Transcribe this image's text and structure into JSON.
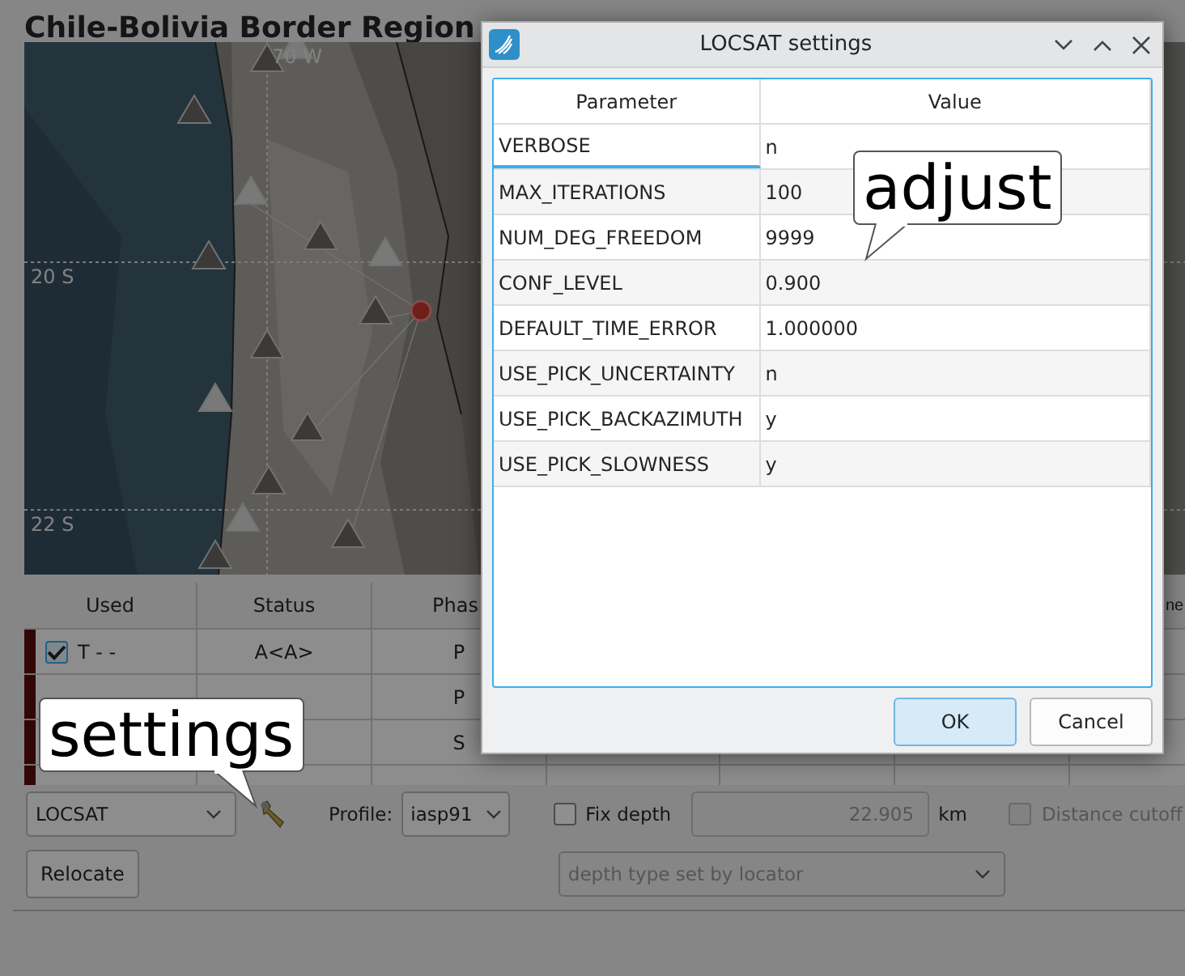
{
  "app": {
    "title": "Chile-Bolivia Border Region",
    "map": {
      "kind": "picture",
      "grid_labels": [
        "70 W",
        "20 S",
        "22 S"
      ]
    },
    "arrivals": {
      "columns": [
        {
          "label": "Used"
        },
        {
          "label": "Status"
        },
        {
          "label": "Phas"
        },
        {},
        {},
        {},
        {
          "label": "ne"
        }
      ],
      "rows": [
        {
          "used": {
            "checked": true
          },
          "cells": [
            "T  - -",
            "A<A>",
            "P",
            null,
            null,
            null,
            null
          ]
        },
        {
          "cells": [
            null,
            null,
            "P",
            null,
            null,
            null,
            null
          ]
        },
        {
          "cells": [
            null,
            null,
            "S",
            null,
            null,
            null,
            null
          ]
        },
        {
          "cells": [
            null,
            null,
            null,
            null,
            null,
            null,
            null
          ]
        }
      ]
    },
    "locator": {
      "value": "LOCSAT"
    },
    "profile": {
      "label": "Profile:",
      "value": "iasp91"
    },
    "fix_depth": {
      "label": "Fix depth",
      "checked": false
    },
    "depth": {
      "value": "22.905",
      "unit": "km",
      "disabled": true
    },
    "distance_cutoff": {
      "label": "Distance cutoff",
      "checked": false,
      "disabled": true
    },
    "relocate": {
      "label": "Relocate"
    },
    "depth_type": {
      "value": "depth type set by locator",
      "disabled": true
    }
  },
  "dialog": {
    "title": "LOCSAT settings",
    "columns": [
      "Parameter",
      "Value"
    ],
    "rows": [
      {
        "parameter": "VERBOSE",
        "value": "n",
        "focused": true
      },
      {
        "parameter": "MAX_ITERATIONS",
        "value": "100",
        "focused": false
      },
      {
        "parameter": "NUM_DEG_FREEDOM",
        "value": "9999",
        "focused": false
      },
      {
        "parameter": "CONF_LEVEL",
        "value": "0.900",
        "focused": false
      },
      {
        "parameter": "DEFAULT_TIME_ERROR",
        "value": "1.000000",
        "focused": false
      },
      {
        "parameter": "USE_PICK_UNCERTAINTY",
        "value": "n",
        "focused": false
      },
      {
        "parameter": "USE_PICK_BACKAZIMUTH",
        "value": "y",
        "focused": false
      },
      {
        "parameter": "USE_PICK_SLOWNESS",
        "value": "y",
        "focused": false
      }
    ],
    "buttons": [
      {
        "label": "OK",
        "selected": true
      },
      {
        "label": "Cancel",
        "selected": false
      }
    ]
  },
  "callouts": [
    {
      "text": "adjust"
    },
    {
      "text": "settings"
    }
  ]
}
